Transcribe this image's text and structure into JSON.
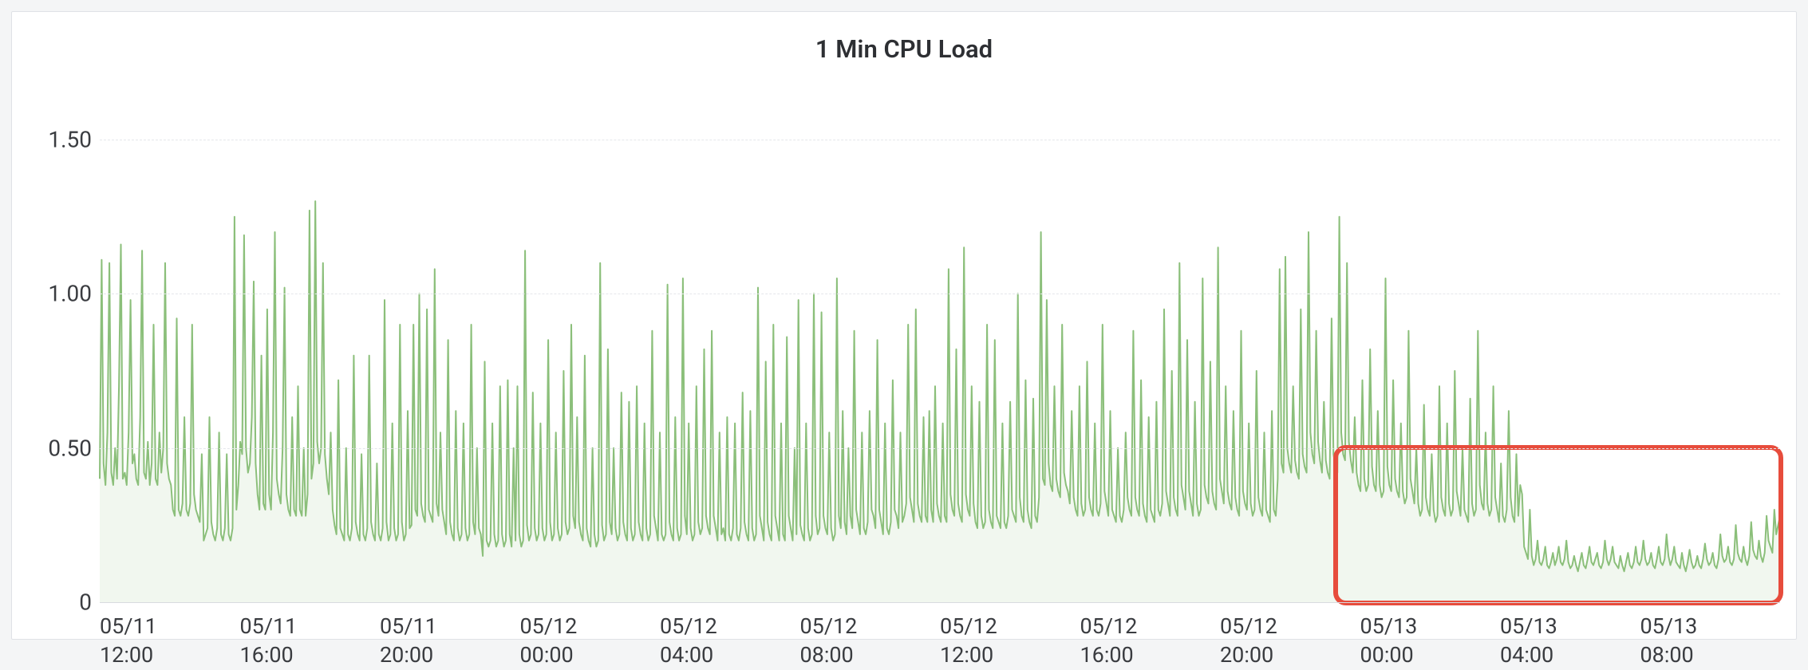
{
  "chart_data": {
    "type": "area",
    "title": "1 Min CPU Load",
    "xlabel": "",
    "ylabel": "",
    "ylim": [
      0,
      1.5
    ],
    "y_ticks": [
      0,
      0.5,
      1.0,
      1.5
    ],
    "y_tick_labels": [
      "0",
      "0.50",
      "1.00",
      "1.50"
    ],
    "x_tick_labels": [
      "05/11\n12:00",
      "05/11\n16:00",
      "05/11\n20:00",
      "05/12\n00:00",
      "05/12\n04:00",
      "05/12\n08:00",
      "05/12\n12:00",
      "05/12\n16:00",
      "05/12\n20:00",
      "05/13\n00:00",
      "05/13\n04:00",
      "05/13\n08:00"
    ],
    "series": [
      {
        "name": "1 Min CPU Load",
        "color": "#8bbf7a",
        "fill": "rgba(139,191,122,0.12)",
        "values": [
          0.4,
          1.11,
          0.45,
          0.38,
          0.55,
          1.1,
          0.42,
          0.38,
          0.5,
          0.4,
          0.7,
          1.16,
          0.4,
          0.42,
          0.38,
          0.55,
          0.98,
          0.45,
          0.48,
          0.4,
          0.38,
          0.6,
          1.14,
          0.42,
          0.4,
          0.52,
          0.38,
          0.45,
          0.9,
          0.4,
          0.38,
          0.55,
          0.42,
          0.5,
          1.1,
          0.45,
          0.4,
          0.38,
          0.3,
          0.28,
          0.92,
          0.3,
          0.28,
          0.32,
          0.6,
          0.3,
          0.28,
          0.32,
          0.9,
          0.35,
          0.3,
          0.28,
          0.26,
          0.48,
          0.2,
          0.22,
          0.24,
          0.6,
          0.26,
          0.22,
          0.2,
          0.24,
          0.55,
          0.22,
          0.2,
          0.24,
          0.48,
          0.22,
          0.2,
          0.24,
          1.25,
          0.3,
          0.38,
          0.52,
          0.48,
          1.19,
          0.5,
          0.42,
          0.45,
          0.6,
          1.04,
          0.45,
          0.35,
          0.3,
          0.8,
          0.32,
          0.3,
          0.95,
          0.35,
          0.3,
          0.55,
          1.2,
          0.4,
          0.35,
          0.32,
          0.5,
          1.02,
          0.35,
          0.3,
          0.28,
          0.6,
          0.3,
          0.28,
          0.7,
          0.3,
          0.28,
          0.5,
          0.28,
          0.35,
          1.27,
          0.4,
          0.45,
          1.3,
          0.52,
          0.45,
          0.5,
          1.1,
          0.48,
          0.4,
          0.35,
          0.55,
          0.3,
          0.25,
          0.22,
          0.72,
          0.24,
          0.22,
          0.2,
          0.5,
          0.22,
          0.2,
          0.24,
          0.8,
          0.26,
          0.22,
          0.2,
          0.48,
          0.22,
          0.2,
          0.24,
          0.8,
          0.26,
          0.22,
          0.2,
          0.45,
          0.22,
          0.2,
          0.24,
          0.98,
          0.26,
          0.2,
          0.22,
          0.58,
          0.24,
          0.2,
          0.22,
          0.9,
          0.26,
          0.2,
          0.22,
          0.62,
          0.24,
          0.25,
          0.9,
          0.3,
          0.28,
          1.0,
          0.32,
          0.28,
          0.26,
          0.95,
          0.3,
          0.28,
          0.26,
          1.08,
          0.32,
          0.28,
          0.55,
          0.3,
          0.26,
          0.22,
          0.85,
          0.26,
          0.22,
          0.2,
          0.62,
          0.24,
          0.2,
          0.22,
          0.58,
          0.24,
          0.2,
          0.22,
          0.9,
          0.26,
          0.22,
          0.5,
          0.24,
          0.22,
          0.15,
          0.78,
          0.2,
          0.18,
          0.2,
          0.58,
          0.22,
          0.18,
          0.2,
          0.7,
          0.22,
          0.18,
          0.2,
          0.72,
          0.22,
          0.18,
          0.5,
          0.2,
          0.7,
          0.22,
          0.18,
          0.2,
          1.14,
          0.25,
          0.2,
          0.22,
          0.68,
          0.24,
          0.2,
          0.22,
          0.58,
          0.24,
          0.2,
          0.22,
          0.85,
          0.26,
          0.2,
          0.22,
          0.55,
          0.24,
          0.2,
          0.22,
          0.75,
          0.26,
          0.22,
          0.24,
          0.9,
          0.28,
          0.24,
          0.6,
          0.26,
          0.22,
          0.2,
          0.8,
          0.24,
          0.2,
          0.18,
          0.5,
          0.22,
          0.18,
          0.2,
          1.1,
          0.25,
          0.2,
          0.22,
          0.82,
          0.26,
          0.22,
          0.5,
          0.24,
          0.2,
          0.22,
          0.68,
          0.26,
          0.22,
          0.2,
          0.65,
          0.24,
          0.2,
          0.22,
          0.7,
          0.26,
          0.22,
          0.2,
          0.58,
          0.24,
          0.2,
          0.22,
          0.88,
          0.28,
          0.24,
          0.2,
          0.55,
          0.22,
          0.2,
          0.22,
          1.03,
          0.26,
          0.22,
          0.2,
          0.6,
          0.24,
          0.2,
          0.22,
          1.05,
          0.28,
          0.22,
          0.58,
          0.24,
          0.2,
          0.22,
          0.7,
          0.26,
          0.22,
          0.24,
          0.82,
          0.28,
          0.24,
          0.22,
          0.88,
          0.28,
          0.24,
          0.2,
          0.55,
          0.22,
          0.24,
          0.2,
          0.6,
          0.22,
          0.2,
          0.24,
          0.58,
          0.22,
          0.2,
          0.24,
          0.68,
          0.26,
          0.22,
          0.2,
          0.62,
          0.24,
          0.2,
          0.22,
          1.02,
          0.28,
          0.24,
          0.2,
          0.78,
          0.26,
          0.22,
          0.2,
          0.9,
          0.28,
          0.24,
          0.2,
          0.58,
          0.22,
          0.2,
          0.86,
          0.28,
          0.24,
          0.2,
          0.5,
          0.22,
          0.98,
          0.25,
          0.22,
          0.2,
          0.58,
          0.24,
          0.2,
          0.22,
          1.0,
          0.28,
          0.22,
          0.24,
          0.94,
          0.28,
          0.24,
          0.22,
          0.55,
          0.24,
          0.2,
          0.22,
          1.05,
          0.28,
          0.24,
          0.62,
          0.26,
          0.22,
          0.5,
          0.28,
          0.24,
          0.88,
          0.3,
          0.26,
          0.22,
          0.55,
          0.24,
          0.22,
          0.26,
          0.62,
          0.3,
          0.28,
          0.24,
          0.85,
          0.3,
          0.26,
          0.22,
          0.58,
          0.24,
          0.22,
          0.26,
          0.72,
          0.3,
          0.28,
          0.24,
          0.55,
          0.26,
          0.28,
          0.32,
          0.9,
          0.34,
          0.3,
          0.26,
          0.95,
          0.32,
          0.28,
          0.26,
          0.6,
          0.28,
          0.26,
          0.62,
          0.3,
          0.26,
          0.7,
          0.32,
          0.28,
          0.26,
          0.58,
          0.28,
          0.26,
          1.08,
          0.35,
          0.3,
          0.28,
          0.82,
          0.32,
          0.28,
          0.26,
          1.15,
          0.35,
          0.3,
          0.28,
          0.7,
          0.32,
          0.26,
          0.24,
          0.65,
          0.28,
          0.24,
          0.26,
          0.9,
          0.3,
          0.26,
          0.24,
          0.85,
          0.28,
          0.26,
          0.24,
          0.58,
          0.26,
          0.24,
          0.28,
          0.65,
          0.3,
          0.28,
          0.26,
          1.0,
          0.34,
          0.28,
          0.26,
          0.72,
          0.3,
          0.26,
          0.24,
          0.66,
          0.28,
          0.26,
          0.34,
          1.2,
          0.4,
          0.38,
          0.98,
          0.45,
          0.38,
          0.36,
          0.7,
          0.4,
          0.36,
          0.34,
          0.9,
          0.42,
          0.38,
          0.36,
          0.32,
          0.62,
          0.34,
          0.3,
          0.28,
          0.7,
          0.32,
          0.28,
          0.3,
          0.78,
          0.34,
          0.3,
          0.28,
          0.58,
          0.3,
          0.28,
          0.32,
          0.9,
          0.36,
          0.32,
          0.28,
          0.62,
          0.3,
          0.28,
          0.26,
          0.5,
          0.28,
          0.26,
          0.3,
          0.55,
          0.34,
          0.3,
          0.28,
          0.88,
          0.34,
          0.3,
          0.28,
          0.72,
          0.32,
          0.28,
          0.26,
          0.6,
          0.3,
          0.28,
          0.26,
          0.65,
          0.3,
          0.28,
          0.32,
          0.95,
          0.36,
          0.32,
          0.28,
          0.75,
          0.34,
          0.3,
          0.28,
          1.1,
          0.38,
          0.34,
          0.3,
          0.85,
          0.36,
          0.32,
          0.28,
          0.65,
          0.32,
          0.28,
          0.3,
          1.05,
          0.38,
          0.34,
          0.32,
          0.78,
          0.36,
          0.32,
          0.3,
          1.15,
          0.4,
          0.36,
          0.32,
          0.7,
          0.36,
          0.32,
          0.3,
          0.62,
          0.34,
          0.3,
          0.28,
          0.88,
          0.36,
          0.32,
          0.3,
          0.58,
          0.32,
          0.28,
          0.3,
          0.75,
          0.34,
          0.3,
          0.28,
          0.55,
          0.3,
          0.28,
          0.26,
          0.62,
          0.3,
          0.28,
          0.4,
          1.08,
          0.45,
          0.42,
          1.12,
          0.5,
          0.45,
          0.42,
          0.7,
          0.46,
          0.42,
          0.4,
          0.95,
          0.48,
          0.44,
          0.42,
          1.2,
          0.55,
          0.48,
          0.45,
          0.88,
          0.52,
          0.46,
          0.42,
          0.65,
          0.46,
          0.42,
          0.4,
          0.92,
          0.48,
          0.44,
          0.42,
          1.25,
          0.55,
          0.48,
          0.46,
          1.1,
          0.52,
          0.46,
          0.42,
          0.6,
          0.42,
          0.38,
          0.36,
          0.72,
          0.4,
          0.36,
          0.38,
          0.82,
          0.44,
          0.38,
          0.36,
          0.62,
          0.38,
          0.34,
          0.36,
          1.05,
          0.44,
          0.38,
          0.36,
          0.72,
          0.4,
          0.36,
          0.34,
          0.58,
          0.36,
          0.32,
          0.34,
          0.88,
          0.4,
          0.36,
          0.32,
          0.5,
          0.32,
          0.28,
          0.3,
          0.64,
          0.34,
          0.3,
          0.28,
          0.48,
          0.3,
          0.26,
          0.28,
          0.7,
          0.34,
          0.3,
          0.28,
          0.58,
          0.32,
          0.28,
          0.3,
          0.75,
          0.36,
          0.32,
          0.28,
          0.5,
          0.3,
          0.28,
          0.26,
          0.66,
          0.32,
          0.28,
          0.3,
          0.88,
          0.38,
          0.32,
          0.3,
          0.55,
          0.32,
          0.28,
          0.3,
          0.7,
          0.34,
          0.3,
          0.26,
          0.45,
          0.28,
          0.26,
          0.3,
          0.62,
          0.34,
          0.28,
          0.26,
          0.48,
          0.28,
          0.38,
          0.35,
          0.18,
          0.16,
          0.14,
          0.3,
          0.15,
          0.12,
          0.14,
          0.2,
          0.13,
          0.12,
          0.14,
          0.18,
          0.12,
          0.11,
          0.13,
          0.16,
          0.12,
          0.14,
          0.18,
          0.13,
          0.12,
          0.14,
          0.2,
          0.13,
          0.11,
          0.12,
          0.15,
          0.12,
          0.1,
          0.13,
          0.16,
          0.12,
          0.11,
          0.14,
          0.18,
          0.13,
          0.12,
          0.14,
          0.16,
          0.12,
          0.11,
          0.13,
          0.2,
          0.14,
          0.12,
          0.14,
          0.18,
          0.13,
          0.12,
          0.11,
          0.15,
          0.12,
          0.1,
          0.13,
          0.16,
          0.12,
          0.11,
          0.13,
          0.18,
          0.13,
          0.12,
          0.14,
          0.2,
          0.14,
          0.12,
          0.13,
          0.16,
          0.12,
          0.11,
          0.14,
          0.18,
          0.13,
          0.12,
          0.14,
          0.22,
          0.15,
          0.12,
          0.14,
          0.18,
          0.13,
          0.12,
          0.11,
          0.16,
          0.12,
          0.1,
          0.13,
          0.17,
          0.13,
          0.11,
          0.12,
          0.15,
          0.12,
          0.11,
          0.14,
          0.19,
          0.14,
          0.12,
          0.13,
          0.16,
          0.12,
          0.11,
          0.14,
          0.22,
          0.15,
          0.13,
          0.14,
          0.18,
          0.13,
          0.12,
          0.14,
          0.25,
          0.16,
          0.14,
          0.13,
          0.18,
          0.14,
          0.12,
          0.15,
          0.26,
          0.17,
          0.15,
          0.14,
          0.2,
          0.15,
          0.13,
          0.16,
          0.28,
          0.2,
          0.18,
          0.16,
          0.3,
          0.22,
          0.25,
          0.28
        ]
      }
    ],
    "highlight": {
      "start_frac": 0.736,
      "end_frac": 1.0,
      "y_top": 0.5,
      "y_bottom": 0.0
    }
  }
}
